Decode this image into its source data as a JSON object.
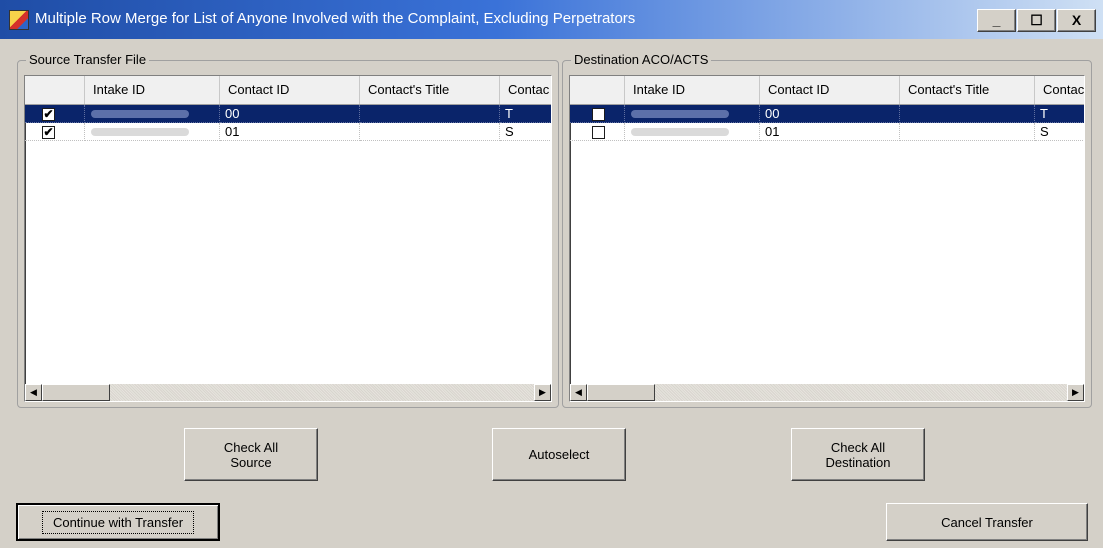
{
  "window": {
    "title": "Multiple Row Merge for List of Anyone Involved with the Complaint, Excluding Perpetrators",
    "minimize": "_",
    "maximize": "☐",
    "close": "X"
  },
  "source": {
    "label": "Source Transfer File",
    "columns": [
      "Intake ID",
      "Contact ID",
      "Contact's Title",
      "Contac"
    ],
    "rows": [
      {
        "checked": true,
        "contact_id": "00",
        "title": "",
        "contact": "T",
        "selected": true
      },
      {
        "checked": true,
        "contact_id": "01",
        "title": "",
        "contact": "S",
        "selected": false
      }
    ]
  },
  "destination": {
    "label": "Destination ACO/ACTS",
    "columns": [
      "Intake ID",
      "Contact ID",
      "Contact's Title",
      "Contac"
    ],
    "rows": [
      {
        "checked": false,
        "contact_id": "00",
        "title": "",
        "contact": "T",
        "selected": true
      },
      {
        "checked": false,
        "contact_id": "01",
        "title": "",
        "contact": "S",
        "selected": false
      }
    ]
  },
  "buttons": {
    "check_all_source": "Check All\nSource",
    "autoselect": "Autoselect",
    "check_all_destination": "Check All\nDestination",
    "continue": "Continue with Transfer",
    "cancel": "Cancel Transfer"
  },
  "scroll_glyphs": {
    "left": "◀",
    "right": "▶"
  },
  "check_glyph": "✔"
}
